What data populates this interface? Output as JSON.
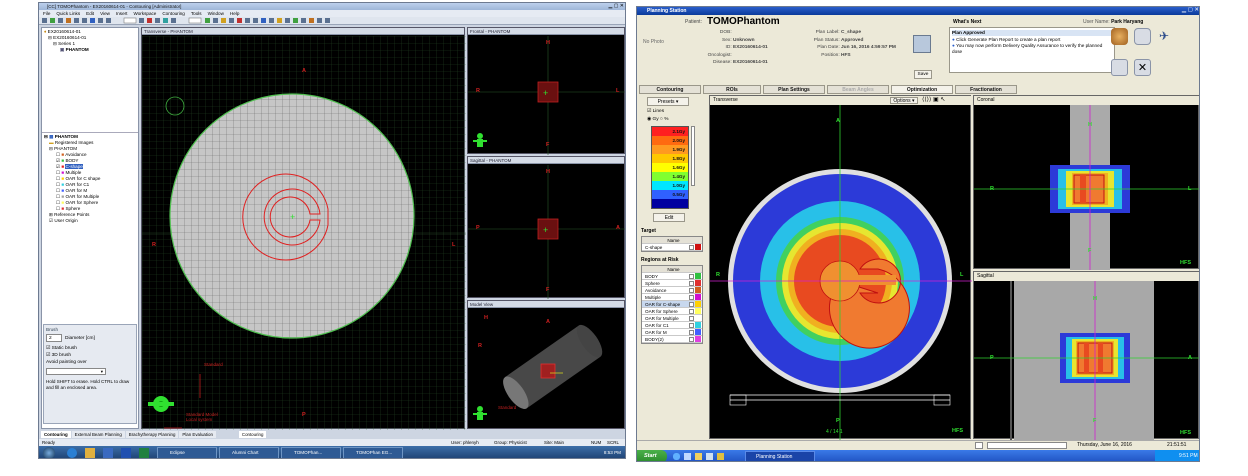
{
  "left": {
    "title": "[CC] TOMOPhantom - EX20160614-01 - Contouring [Administrator]",
    "menus": [
      "File",
      "Quick Links",
      "Edit",
      "View",
      "Insert",
      "Workspace",
      "Contouring",
      "Tools",
      "Window",
      "Help"
    ],
    "tree_top": [
      "EX20160614-01",
      "EX20160614-01",
      "Series 1",
      "PHANTOM"
    ],
    "tree": [
      "PHANTOM",
      "Registered Images",
      "PHANTOM",
      "Avoidance",
      "BODY",
      "C-shape",
      "Multiple",
      "OAR for C shape",
      "OAR for C1",
      "OAR for M",
      "OAR for Multiple",
      "OAR for Sphere",
      "Sphere",
      "Reference Points",
      "User Origin"
    ],
    "views": {
      "transverse": "Transverse - PHANTOM",
      "frontal": "Frontal - PHANTOM",
      "sagittal": "Sagittal - PHANTOM",
      "model": "Model View"
    },
    "orient": {
      "A": "A",
      "P": "P",
      "R": "R",
      "L": "L",
      "H": "H",
      "F": "F"
    },
    "brush": {
      "title": "Brush",
      "diameter_value": "2",
      "diameter_label": "Diameter [cm]",
      "static": "Static brush",
      "threed": "3D brush",
      "avoid": "Avoid painting over",
      "hint": "Hold SHIFT to erase. Hold CTRL to draw and fill an enclosed area."
    },
    "overlay": {
      "standard": "Standard",
      "bottom": "Standard Model\nLocal system"
    },
    "tabs": [
      "Contouring",
      "External Beam Planning",
      "Brachytherapy Planning",
      "Plan Evaluation",
      "Contouring"
    ],
    "status": {
      "ready": "Ready",
      "user": "User: phlenyh",
      "group": "Group: Physicist",
      "site": "Site: Main",
      "num": "NUM",
      "scrl": "SCRL"
    },
    "taskbar": [
      "Eclipse",
      "Alumni Chart",
      "Outlook",
      "Word",
      "Excel",
      "TOMOPhan...",
      "TOMOPhan EG..."
    ],
    "clock": "8:53 PM"
  },
  "right": {
    "title": "Planning Station",
    "patient_label": "Patient:",
    "patient": "TOMOPhantom",
    "nophoto": "No Photo",
    "fields": [
      [
        "DOB:",
        ""
      ],
      [
        "Sex:",
        "Unknown"
      ],
      [
        "ID:",
        "EX20160614-01"
      ],
      [
        "Oncologist:",
        ""
      ],
      [
        "Disease:",
        "EX20160614-01"
      ]
    ],
    "plan": [
      [
        "Plan Label:",
        "C_shape"
      ],
      [
        "Plan Status:",
        "Approved"
      ],
      [
        "Plan Date:",
        "Jun 16, 2016 4:59:57 PM"
      ],
      [
        "Position:",
        "HFS"
      ]
    ],
    "save": "Save",
    "next_title": "What's Next",
    "next_status": "Plan Approved",
    "next_items": [
      "Click Generate Plan Report to create a plan report",
      "You may now perform Delivery Quality Assurance to verify the planned dose"
    ],
    "user_label": "User Name:",
    "user": "Park Haryang",
    "tabs": [
      "Contouring",
      "ROIs",
      "Plan Settings",
      "Beam Angles",
      "Optimization",
      "Fractionation"
    ],
    "presets": "Presets",
    "lines": "Lines",
    "units": [
      "Gy",
      "%"
    ],
    "levels": [
      {
        "v": "2.1Gy",
        "c": "#ff2020"
      },
      {
        "v": "2.0Gy",
        "c": "#ff6a10"
      },
      {
        "v": "1.9Gy",
        "c": "#ff9a20"
      },
      {
        "v": "1.8Gy",
        "c": "#ffc800"
      },
      {
        "v": "1.6Gy",
        "c": "#ffff00"
      },
      {
        "v": "1.4Gy",
        "c": "#80ff30"
      },
      {
        "v": "1.0Gy",
        "c": "#00e6ff"
      },
      {
        "v": "0.5Gy",
        "c": "#3060ff"
      },
      {
        "v": "",
        "c": "#0000a0"
      }
    ],
    "edit": "Edit",
    "target_title": "Target",
    "name_col": "Name",
    "targets": [
      {
        "n": "C-shape",
        "c": "#d01010"
      }
    ],
    "oar_title": "Regions at Risk",
    "oars": [
      {
        "n": "BODY",
        "c": "#30c040"
      },
      {
        "n": "Sphere",
        "c": "#e03030"
      },
      {
        "n": "Avoidance",
        "c": "#d06020"
      },
      {
        "n": "Multiple",
        "c": "#d010d0"
      },
      {
        "n": "OAR for C-shape",
        "c": "#ffd000"
      },
      {
        "n": "OAR for Sphere",
        "c": "#ffff60"
      },
      {
        "n": "OAR for Multiple",
        "c": "#ffffff"
      },
      {
        "n": "OAR for C1",
        "c": "#30d0e0"
      },
      {
        "n": "OAR for M",
        "c": "#4060ff"
      },
      {
        "n": "BODY(2)",
        "c": "#e040e0"
      }
    ],
    "view_labels": {
      "transverse": "Transverse",
      "coronal": "Coronal",
      "sagittal": "Sagittal",
      "options": "Options"
    },
    "orient": {
      "A": "A",
      "P": "P",
      "R": "R",
      "L": "L",
      "H": "H",
      "F": "F",
      "HFS": "HFS"
    },
    "slice": "4 / 14 1",
    "status_date": "Thursday, June 16, 2016",
    "status_time": "21:51:51",
    "taskbar": [
      "Start",
      "Planning Station"
    ],
    "clock": "9:51 PM"
  }
}
